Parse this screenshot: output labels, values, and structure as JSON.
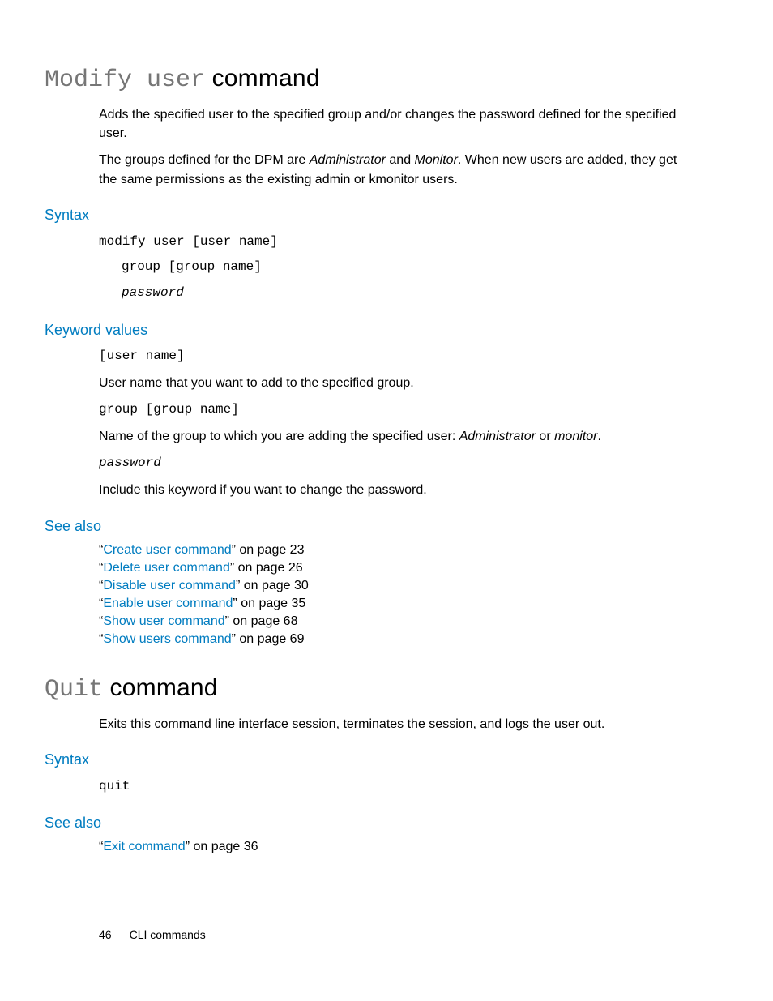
{
  "section1": {
    "title_mono": "Modify user",
    "title_rest": " command",
    "para1a": "Adds the specified user to the specified group and/or changes the password defined for the specified user.",
    "para2_pre": "The groups defined for the DPM are ",
    "para2_i1": "Administrator",
    "para2_mid": " and ",
    "para2_i2": "Monitor",
    "para2_post": ". When new users are added, they get the same permissions as the existing admin or kmonitor users.",
    "syntax_head": "Syntax",
    "syntax_l1": "modify user [user name]",
    "syntax_l2": "group [group name]",
    "syntax_l3": "password",
    "kv_head": "Keyword values",
    "kv1_code": "[user name]",
    "kv1_desc": "User name that you want to add to the specified group.",
    "kv2_code": "group [group name]",
    "kv2_desc_pre": "Name of the group to which you are adding the specified user: ",
    "kv2_desc_i1": "Administrator",
    "kv2_desc_mid": " or ",
    "kv2_desc_i2": "monitor",
    "kv2_desc_post": ".",
    "kv3_code": "password",
    "kv3_desc": "Include this keyword if you want to change the password.",
    "seealso_head": "See also",
    "seealso": [
      {
        "q1": "“",
        "link": "Create user command",
        "q2": "”",
        "suffix": " on page 23"
      },
      {
        "q1": "“",
        "link": "Delete user command",
        "q2": "”",
        "suffix": " on page 26"
      },
      {
        "q1": "“",
        "link": "Disable user command",
        "q2": "”",
        "suffix": " on page 30"
      },
      {
        "q1": "“",
        "link": "Enable user command",
        "q2": "”",
        "suffix": " on page 35"
      },
      {
        "q1": "“",
        "link": "Show user command",
        "q2": "”",
        "suffix": " on page 68"
      },
      {
        "q1": "“",
        "link": "Show users command",
        "q2": "”",
        "suffix": " on page 69"
      }
    ]
  },
  "section2": {
    "title_mono": "Quit",
    "title_rest": " command",
    "para1": "Exits this command line interface session, terminates the session, and logs the user out.",
    "syntax_head": "Syntax",
    "syntax_l1": "quit",
    "seealso_head": "See also",
    "seealso": [
      {
        "q1": "“",
        "link": "Exit command",
        "q2": "”",
        "suffix": " on page 36"
      }
    ]
  },
  "footer": {
    "page": "46",
    "label": "CLI commands"
  }
}
